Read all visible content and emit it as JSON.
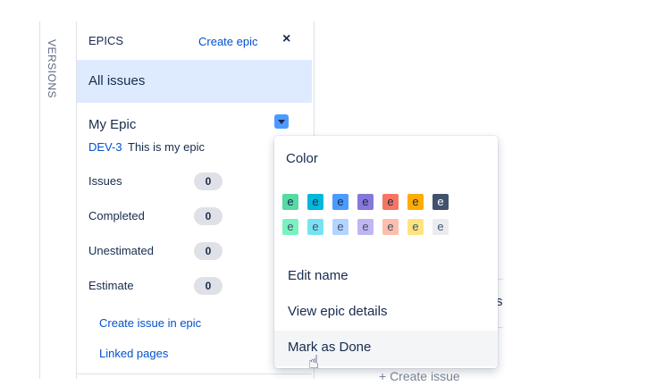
{
  "side_tab": {
    "label": "VERSIONS"
  },
  "epics_panel": {
    "title": "EPICS",
    "create_epic": "Create epic",
    "close": "×",
    "all_issues": "All issues",
    "epic": {
      "name": "My Epic",
      "key": "DEV-3",
      "summary": "This is my epic",
      "stats": [
        {
          "label": "Issues",
          "value": "0"
        },
        {
          "label": "Completed",
          "value": "0"
        },
        {
          "label": "Unestimated",
          "value": "0"
        },
        {
          "label": "Estimate",
          "value": "0"
        }
      ]
    },
    "links": [
      "Create issue in epic",
      "Linked pages"
    ]
  },
  "background": {
    "fragment_s": "s",
    "create_issue": "+ Create issue"
  },
  "dropdown": {
    "color_heading": "Color",
    "swatch_letter": "e",
    "swatch_colors_row1": [
      "#57d9a3",
      "#00b8d9",
      "#4c9aff",
      "#8777d9",
      "#f87462",
      "#ffab00",
      "#42526e"
    ],
    "swatch_text_row1": [
      "#172b4d",
      "#172b4d",
      "#172b4d",
      "#172b4d",
      "#172b4d",
      "#172b4d",
      "#ffffff"
    ],
    "swatch_colors_row2": [
      "#79f2c0",
      "#79e2f2",
      "#b3d4ff",
      "#c0b6f2",
      "#ffbdad",
      "#ffe380",
      "#ebecf0"
    ],
    "items": [
      "Edit name",
      "View epic details",
      "Mark as Done"
    ]
  },
  "colors": {
    "link": "#0052cc",
    "selected_bg": "#deebff",
    "badge_bg": "#dfe1e6",
    "hover_bg": "#f4f5f7"
  }
}
